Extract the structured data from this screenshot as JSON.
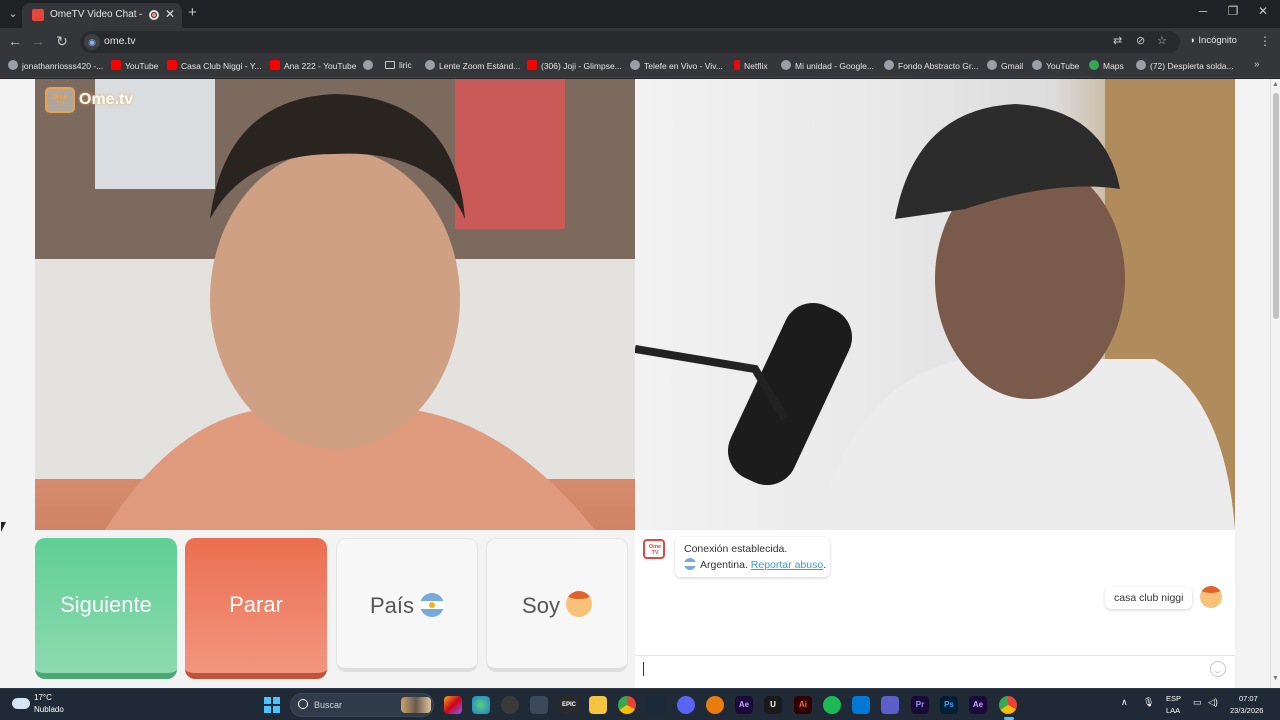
{
  "browser": {
    "tab_title": "OmeTV Video Chat — Ome",
    "url": "ome.tv",
    "incognito_label": "Incógnito",
    "bookmarks": [
      {
        "label": "jonathanriosss420 -...",
        "icon": "profile-icon"
      },
      {
        "label": "YouTube",
        "icon": "youtube-icon"
      },
      {
        "label": "Casa Club Niggi - Y...",
        "icon": "youtube-icon"
      },
      {
        "label": "Ana 222 - YouTube",
        "icon": "youtube-icon"
      },
      {
        "label": "",
        "icon": "globe-icon"
      },
      {
        "label": "liric",
        "icon": "folder-icon"
      },
      {
        "label": "Lente Zoom Estánd...",
        "icon": "globe-icon"
      },
      {
        "label": "(306) Joji - Glimpse...",
        "icon": "youtube-icon"
      },
      {
        "label": "Telefe en Vivo - Viv...",
        "icon": "globe-icon"
      },
      {
        "label": "Netflix",
        "icon": "netflix-icon"
      },
      {
        "label": "Mi unidad - Google...",
        "icon": "drive-icon"
      },
      {
        "label": "Fondo Abstracto Gr...",
        "icon": "globe-icon"
      },
      {
        "label": "Gmail",
        "icon": "globe-icon"
      },
      {
        "label": "YouTube",
        "icon": "globe-icon"
      },
      {
        "label": "Maps",
        "icon": "maps-icon"
      },
      {
        "label": "(72) Despierta solda...",
        "icon": "globe-icon"
      }
    ]
  },
  "page": {
    "logo_badge": "Ome TV",
    "logo_text": "Ome.tv",
    "buttons": {
      "next": "Siguiente",
      "stop": "Parar",
      "country": "País",
      "gender": "Soy"
    },
    "chat": {
      "icon_text": "Ome TV",
      "system_line1": "Conexión establecida.",
      "system_country": "Argentina.",
      "report_link": "Reportar abuso",
      "report_after": ".",
      "my_message": "casa club niggi",
      "input_value": ""
    }
  },
  "taskbar": {
    "weather_temp": "17°C",
    "weather_desc": "Nublado",
    "search_placeholder": "Buscar",
    "lang_line1": "ESP",
    "lang_line2": "LAA",
    "time": "07:07",
    "date": "23/3/2026"
  },
  "colors": {
    "next_button": "#5fcf94",
    "stop_button": "#ec6e50",
    "link": "#3a9ad9",
    "taskbar": "#1f2a36"
  }
}
